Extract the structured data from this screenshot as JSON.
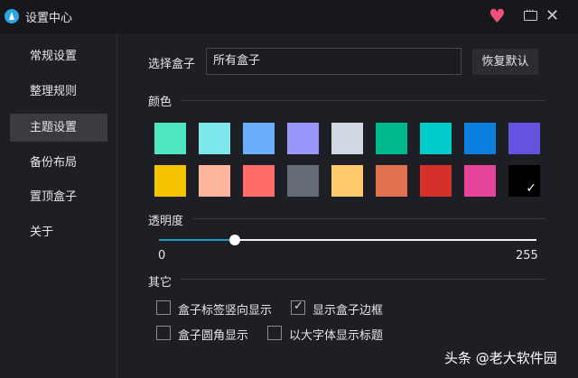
{
  "window": {
    "title": "设置中心"
  },
  "sidebar": {
    "items": [
      {
        "label": "常规设置"
      },
      {
        "label": "整理规则"
      },
      {
        "label": "主题设置",
        "active": true
      },
      {
        "label": "备份布局"
      },
      {
        "label": "置顶盒子"
      },
      {
        "label": "关于"
      }
    ]
  },
  "main": {
    "select_label": "选择盒子",
    "select_value": "所有盒子",
    "restore_label": "恢复默认",
    "color_title": "颜色",
    "colors": [
      "#4ee8c0",
      "#7ee8ee",
      "#6aaefc",
      "#9a96fc",
      "#d0d8e2",
      "#00b88e",
      "#00cccc",
      "#0a7fe0",
      "#6452e0",
      "#f5c400",
      "#ffb49e",
      "#ff6e66",
      "#636c75",
      "#fdc96a",
      "#e07150",
      "#d6302b",
      "#e6449a",
      "#000000"
    ],
    "selected_color_index": 17,
    "opacity_title": "透明度",
    "opacity_min": "0",
    "opacity_max": "255",
    "opacity_value": 51,
    "other_title": "其它",
    "options": [
      {
        "label": "盒子标签竖向显示",
        "checked": false
      },
      {
        "label": "显示盒子边框",
        "checked": true
      },
      {
        "label": "盒子圆角显示",
        "checked": false
      },
      {
        "label": "以大字体显示标题",
        "checked": false
      }
    ]
  },
  "watermark": "头条 @老大软件园"
}
